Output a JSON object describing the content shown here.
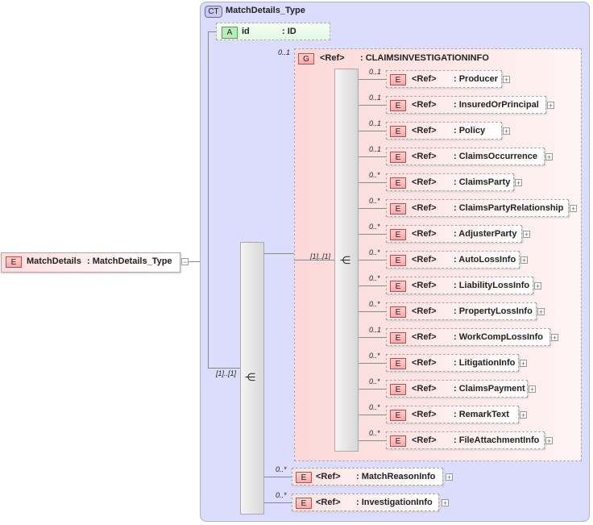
{
  "root": {
    "badge": "E",
    "name": "MatchDetails",
    "type": ": MatchDetails_Type",
    "toggle": "−"
  },
  "complex_type": {
    "badge": "CT",
    "name": "MatchDetails_Type"
  },
  "attribute": {
    "badge": "A",
    "name": "id",
    "type": ": ID"
  },
  "outer_sequence": {
    "cardinality": "[1]..[1]"
  },
  "group": {
    "badge": "G",
    "ref": "<Ref>",
    "name": ": CLAIMSINVESTIGATIONINFO",
    "cardinality": "0..1"
  },
  "inner_sequence": {
    "cardinality": "[1]..[1]"
  },
  "group_elements": [
    {
      "card": "0..1",
      "ref": "<Ref>",
      "name": ": Producer"
    },
    {
      "card": "0..1",
      "ref": "<Ref>",
      "name": ": InsuredOrPrincipal"
    },
    {
      "card": "0..1",
      "ref": "<Ref>",
      "name": ": Policy"
    },
    {
      "card": "0..1",
      "ref": "<Ref>",
      "name": ": ClaimsOccurrence"
    },
    {
      "card": "0..*",
      "ref": "<Ref>",
      "name": ": ClaimsParty"
    },
    {
      "card": "0..*",
      "ref": "<Ref>",
      "name": ": ClaimsPartyRelationship"
    },
    {
      "card": "0..*",
      "ref": "<Ref>",
      "name": ": AdjusterParty"
    },
    {
      "card": "0..*",
      "ref": "<Ref>",
      "name": ": AutoLossInfo"
    },
    {
      "card": "0..*",
      "ref": "<Ref>",
      "name": ": LiabilityLossInfo"
    },
    {
      "card": "0..*",
      "ref": "<Ref>",
      "name": ": PropertyLossInfo"
    },
    {
      "card": "0..1",
      "ref": "<Ref>",
      "name": ": WorkCompLossInfo"
    },
    {
      "card": "0..*",
      "ref": "<Ref>",
      "name": ": LitigationInfo"
    },
    {
      "card": "0..*",
      "ref": "<Ref>",
      "name": ": ClaimsPayment"
    },
    {
      "card": "0..*",
      "ref": "<Ref>",
      "name": ": RemarkText"
    },
    {
      "card": "0..*",
      "ref": "<Ref>",
      "name": ": FileAttachmentInfo"
    }
  ],
  "outer_elements": [
    {
      "card": "0..*",
      "ref": "<Ref>",
      "name": ": MatchReasonInfo"
    },
    {
      "card": "0..*",
      "ref": "<Ref>",
      "name": ": InvestigationInfo"
    }
  ],
  "element_badge": "E",
  "expand": "+"
}
